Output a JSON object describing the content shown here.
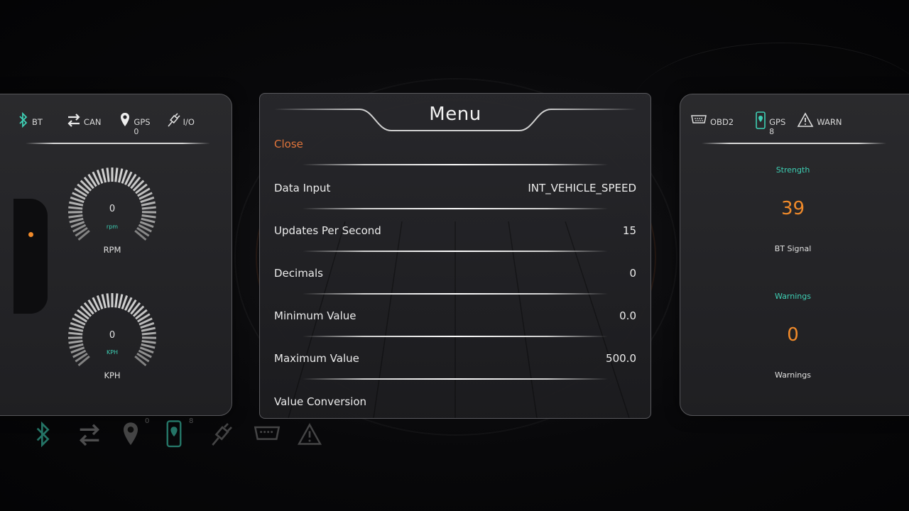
{
  "left_panel": {
    "status": [
      {
        "label": "BT",
        "icon": "bluetooth-icon"
      },
      {
        "label": "CAN",
        "icon": "transfer-arrows-icon"
      },
      {
        "label": "GPS",
        "sub": "0",
        "icon": "location-pin-icon"
      },
      {
        "label": "I/O",
        "icon": "plug-icon"
      }
    ],
    "gauges": [
      {
        "value": "0",
        "unit": "rpm",
        "label": "RPM"
      },
      {
        "value": "0",
        "unit": "KPH",
        "label": "KPH"
      }
    ]
  },
  "menu": {
    "title": "Menu",
    "close_label": "Close",
    "rows": [
      {
        "label": "Data Input",
        "value": "INT_VEHICLE_SPEED"
      },
      {
        "label": "Updates Per Second",
        "value": "15"
      },
      {
        "label": "Decimals",
        "value": "0"
      },
      {
        "label": "Minimum Value",
        "value": "0.0"
      },
      {
        "label": "Maximum Value",
        "value": "500.0"
      },
      {
        "label": "Value Conversion",
        "value": ""
      }
    ]
  },
  "right_panel": {
    "status": [
      {
        "label": "OBD2",
        "icon": "obd-port-icon"
      },
      {
        "label": "GPS",
        "sub": "8",
        "icon": "phone-location-icon"
      },
      {
        "label": "WARN",
        "icon": "warning-triangle-icon"
      }
    ],
    "strength": {
      "title": "Strength",
      "value": "39",
      "caption": "BT Signal"
    },
    "warnings": {
      "title": "Warnings",
      "value": "0",
      "caption": "Warnings"
    }
  },
  "dock": {
    "items": [
      {
        "icon": "bluetooth-icon"
      },
      {
        "icon": "transfer-arrows-icon"
      },
      {
        "icon": "location-pin-icon",
        "badge": "0"
      },
      {
        "icon": "phone-location-icon",
        "badge": "8"
      },
      {
        "icon": "plug-icon"
      },
      {
        "icon": "obd-port-icon"
      },
      {
        "icon": "warning-triangle-icon"
      }
    ]
  },
  "colors": {
    "accent": "#f08a2a",
    "teal": "#3ecfb4",
    "close": "#e0743a"
  }
}
